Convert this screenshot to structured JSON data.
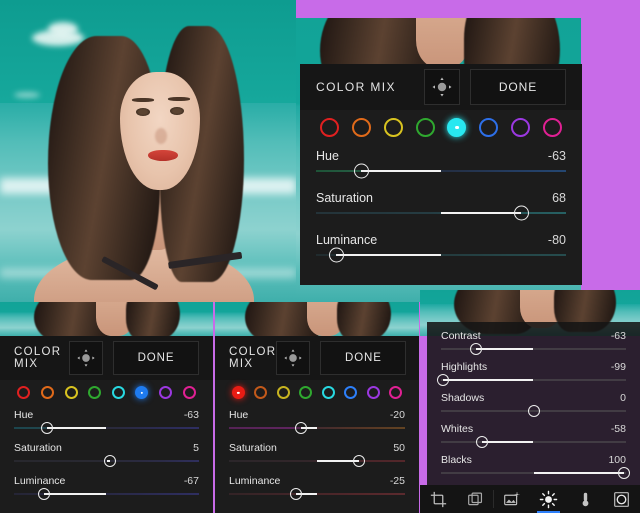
{
  "app": {
    "background_color": "#C86BE8",
    "panel_color": "#1C1C1C"
  },
  "panels": [
    {
      "id": "main-color-mix",
      "title": "COLOR MIX",
      "done_label": "DONE",
      "target_icon": "target-move-icon",
      "selected_swatch_index": 4,
      "swatches": [
        {
          "name": "red",
          "color": "#E02020"
        },
        {
          "name": "orange",
          "color": "#E06A1A"
        },
        {
          "name": "yellow",
          "color": "#D8C320"
        },
        {
          "name": "green",
          "color": "#2FA82F"
        },
        {
          "name": "cyan",
          "color": "#28E8F0"
        },
        {
          "name": "blue",
          "color": "#2D6FE8"
        },
        {
          "name": "purple",
          "color": "#9B38E0"
        },
        {
          "name": "magenta",
          "color": "#E02093"
        }
      ],
      "sliders": [
        {
          "label": "Hue",
          "value": "-63",
          "pct": 18,
          "base_gradient": "linear-gradient(90deg,#1f8a52 0%,#2e9e6a 16%,#3a3f52 30%,#2b4470 55%,#2b5ea8 80%,#2b72c8 100%)"
        },
        {
          "label": "Saturation",
          "value": "68",
          "pct": 82,
          "base_gradient": "linear-gradient(90deg,#2b4a56 0%,#2e5c68 45%,#2f8f94 80%,#31a6ab 100%)"
        },
        {
          "label": "Luminance",
          "value": "-80",
          "pct": 8,
          "base_gradient": "linear-gradient(90deg,#253a40 0%,#2a4e55 40%,#2e6e72 75%,#2f7d80 100%)"
        }
      ]
    },
    {
      "id": "left-color-mix",
      "title": "COLOR MIX",
      "done_label": "DONE",
      "target_icon": "target-move-icon",
      "selected_swatch_index": 5,
      "swatches": [
        {
          "name": "red",
          "color": "#E02020"
        },
        {
          "name": "orange",
          "color": "#E06A1A"
        },
        {
          "name": "yellow",
          "color": "#D8C320"
        },
        {
          "name": "green",
          "color": "#2FA82F"
        },
        {
          "name": "cyan",
          "color": "#28D8E0"
        },
        {
          "name": "blue",
          "color": "#1E7BF0"
        },
        {
          "name": "purple",
          "color": "#9B38E0"
        },
        {
          "name": "magenta",
          "color": "#E02093"
        }
      ],
      "sliders": [
        {
          "label": "Hue",
          "value": "-63",
          "pct": 18,
          "base_gradient": "linear-gradient(90deg,#1c6f80 0%,#24707e 14%,#3a3a4a 30%,#37375e 55%,#3b3b8c 80%,#4040a8 100%)"
        },
        {
          "label": "Saturation",
          "value": "5",
          "pct": 52,
          "base_gradient": "linear-gradient(90deg,#33333f 0%,#363648 45%,#3a3a72 80%,#4242a0 100%)"
        },
        {
          "label": "Luminance",
          "value": "-67",
          "pct": 16,
          "base_gradient": "linear-gradient(90deg,#2e2e50 0%,#343460 40%,#3a3a88 75%,#4040a5 100%)"
        }
      ]
    },
    {
      "id": "mid-color-mix",
      "title": "COLOR MIX",
      "done_label": "DONE",
      "target_icon": "target-move-icon",
      "selected_swatch_index": 0,
      "swatches": [
        {
          "name": "red",
          "color": "#E81C14"
        },
        {
          "name": "orange",
          "color": "#C2591A"
        },
        {
          "name": "yellow",
          "color": "#C8B420"
        },
        {
          "name": "green",
          "color": "#2FA82F"
        },
        {
          "name": "cyan",
          "color": "#28D8E0"
        },
        {
          "name": "blue",
          "color": "#2D7FF9"
        },
        {
          "name": "purple",
          "color": "#9B38E0"
        },
        {
          "name": "magenta",
          "color": "#E02093"
        }
      ],
      "sliders": [
        {
          "label": "Hue",
          "value": "-20",
          "pct": 41,
          "base_gradient": "linear-gradient(90deg,#8e2a8e 0%,#a02da0 35%,#6a3a42 50%,#8a4b32 72%,#a86a28 100%)"
        },
        {
          "label": "Saturation",
          "value": "50",
          "pct": 74,
          "base_gradient": "linear-gradient(90deg,#3a3038 0%,#4a3038 45%,#7a3038 80%,#8e3238 100%)"
        },
        {
          "label": "Luminance",
          "value": "-25",
          "pct": 38,
          "base_gradient": "linear-gradient(90deg,#4a2a30 0%,#6a2e34 40%,#8a3238 75%,#9a3840 100%)"
        }
      ]
    },
    {
      "id": "light-panel",
      "sliders": [
        {
          "label": "Contrast",
          "value": "-63",
          "pct": 19
        },
        {
          "label": "Highlights",
          "value": "-99",
          "pct": 1
        },
        {
          "label": "Shadows",
          "value": "0",
          "pct": 50
        },
        {
          "label": "Whites",
          "value": "-58",
          "pct": 22
        },
        {
          "label": "Blacks",
          "value": "100",
          "pct": 99
        }
      ],
      "toolbar": {
        "active_index": 3,
        "tools": [
          {
            "name": "crop-icon",
            "label": "Crop"
          },
          {
            "name": "layers-icon",
            "label": "Layers"
          },
          {
            "name": "image-effect-icon",
            "label": "Effects"
          },
          {
            "name": "brightness-icon",
            "label": "Light"
          },
          {
            "name": "temperature-icon",
            "label": "Color"
          },
          {
            "name": "vignette-icon",
            "label": "Detail"
          }
        ]
      }
    }
  ]
}
